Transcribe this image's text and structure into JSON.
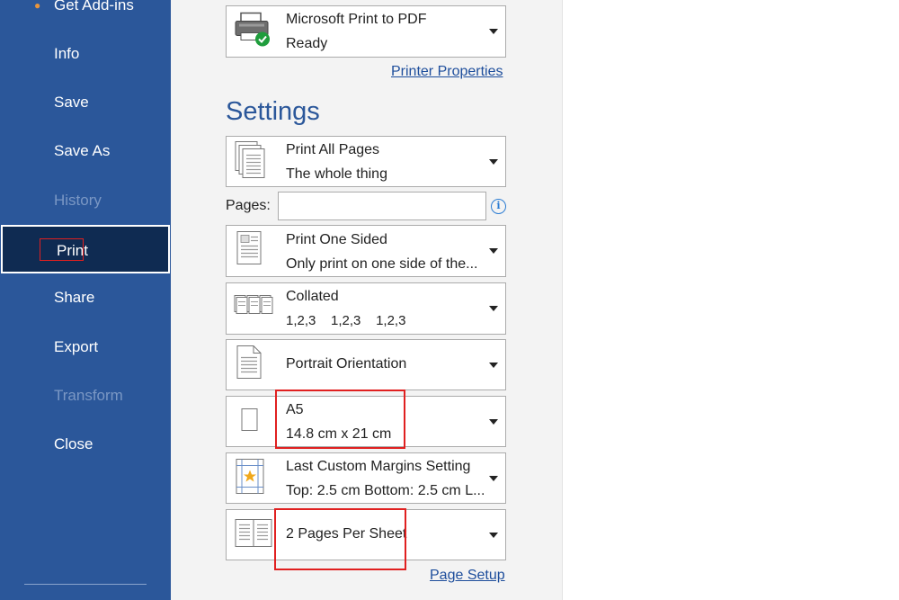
{
  "nav": {
    "get_addins": "Get Add-ins",
    "info": "Info",
    "save": "Save",
    "save_as": "Save As",
    "history": "History",
    "print": "Print",
    "share": "Share",
    "export": "Export",
    "transform": "Transform",
    "close": "Close"
  },
  "printer": {
    "name": "Microsoft Print to PDF",
    "status": "Ready",
    "properties_link": "Printer Properties"
  },
  "settings": {
    "title": "Settings",
    "print_range": {
      "label": "Print All Pages",
      "sub": "The whole thing"
    },
    "pages": {
      "label": "Pages:",
      "value": "",
      "placeholder": ""
    },
    "sides": {
      "label": "Print One Sided",
      "sub": "Only print on one side of the..."
    },
    "collation": {
      "label": "Collated",
      "sub": "1,2,3    1,2,3    1,2,3"
    },
    "orientation": {
      "label": "Portrait Orientation"
    },
    "paper_size": {
      "label": "A5",
      "sub": "14.8 cm x 21 cm"
    },
    "margins": {
      "label": "Last Custom Margins Setting",
      "sub": "Top: 2.5 cm Bottom: 2.5 cm L..."
    },
    "pages_per_sheet": {
      "label": "2 Pages Per Sheet"
    },
    "page_setup_link": "Page Setup"
  },
  "colors": {
    "nav_bg": "#2b579a",
    "nav_active_bg": "#0f2b52",
    "accent": "#2b579a",
    "highlight_box": "#e02020",
    "link": "#1e4e9c"
  },
  "icons": {
    "printer": "printer-icon",
    "check": "ready-check-icon",
    "print_range": "pages-stack-icon",
    "sides": "one-sided-page-icon",
    "collation": "collated-pages-icon",
    "orientation": "portrait-page-icon",
    "paper_size": "paper-size-icon",
    "margins": "margins-icon",
    "pages_per_sheet": "two-pages-icon",
    "info": "info-icon",
    "dropdown": "chevron-down-icon"
  }
}
